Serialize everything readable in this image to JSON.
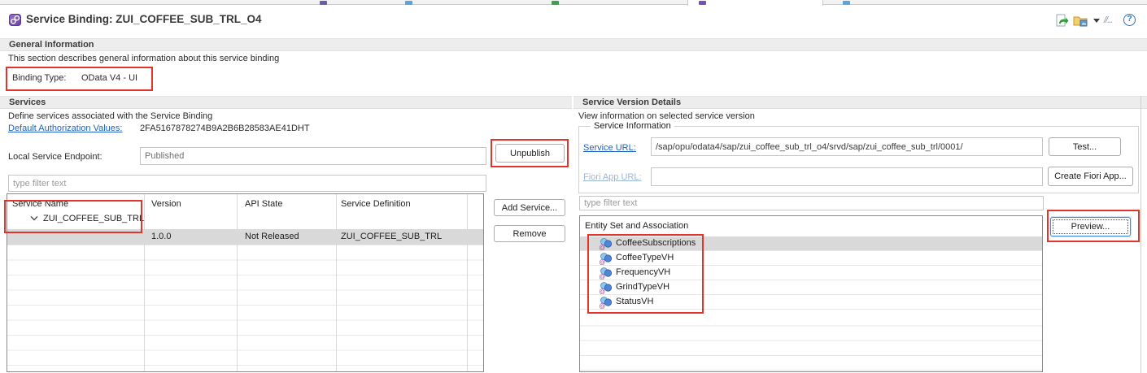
{
  "window": {
    "title": "Service Binding: ZUI_COFFEE_SUB_TRL_O4"
  },
  "toolbar": {
    "icons": [
      "activate-icon",
      "open-folder-icon",
      "dropdown-caret-icon",
      "slashes-more-icon",
      "help-icon"
    ],
    "help_glyph": "?",
    "slashes_glyph": "//..."
  },
  "general": {
    "header": "General Information",
    "description": "This section describes general information about this service binding",
    "binding_type_label": "Binding Type:",
    "binding_type_value": "OData V4 - UI"
  },
  "services": {
    "header": "Services",
    "description": "Define services associated with the Service Binding",
    "auth_link": "Default Authorization Values:",
    "auth_value": "2FA5167878274B9A2B6B28583AE41DHT",
    "endpoint_label": "Local Service Endpoint:",
    "endpoint_value": "Published",
    "unpublish_button": "Unpublish",
    "filter_placeholder": "type filter text",
    "table": {
      "columns": [
        "Service Name",
        "Version",
        "API State",
        "Service Definition"
      ],
      "tree_item": "ZUI_COFFEE_SUB_TRL",
      "row": {
        "version": "1.0.0",
        "api_state": "Not Released",
        "service_definition": "ZUI_COFFEE_SUB_TRL"
      }
    },
    "add_button": "Add Service...",
    "remove_button": "Remove"
  },
  "version_details": {
    "header": "Service Version Details",
    "description": "View information on selected service version",
    "group_title": "Service Information",
    "service_url_label": "Service URL:",
    "service_url_value": "/sap/opu/odata4/sap/zui_coffee_sub_trl_o4/srvd/sap/zui_coffee_sub_trl/0001/",
    "test_button": "Test...",
    "fiori_label": "Fiori App URL:",
    "fiori_value": "",
    "create_fiori_button": "Create Fiori App...",
    "filter_placeholder": "type filter text",
    "entity_header": "Entity Set and Association",
    "entities": [
      "CoffeeSubscriptions",
      "CoffeeTypeVH",
      "FrequencyVH",
      "GrindTypeVH",
      "StatusVH"
    ],
    "preview_button": "Preview..."
  },
  "colors": {
    "annotation_red": "#e3342c",
    "link_blue": "#1f63c0",
    "disabled_link": "#9cb8d8",
    "selection_gray": "#d9d9d9",
    "icon_purple": "#7a4fb5",
    "icon_green": "#2e9e3e",
    "icon_blue": "#4f86d8",
    "icon_folder_yellow": "#e8b64c"
  }
}
